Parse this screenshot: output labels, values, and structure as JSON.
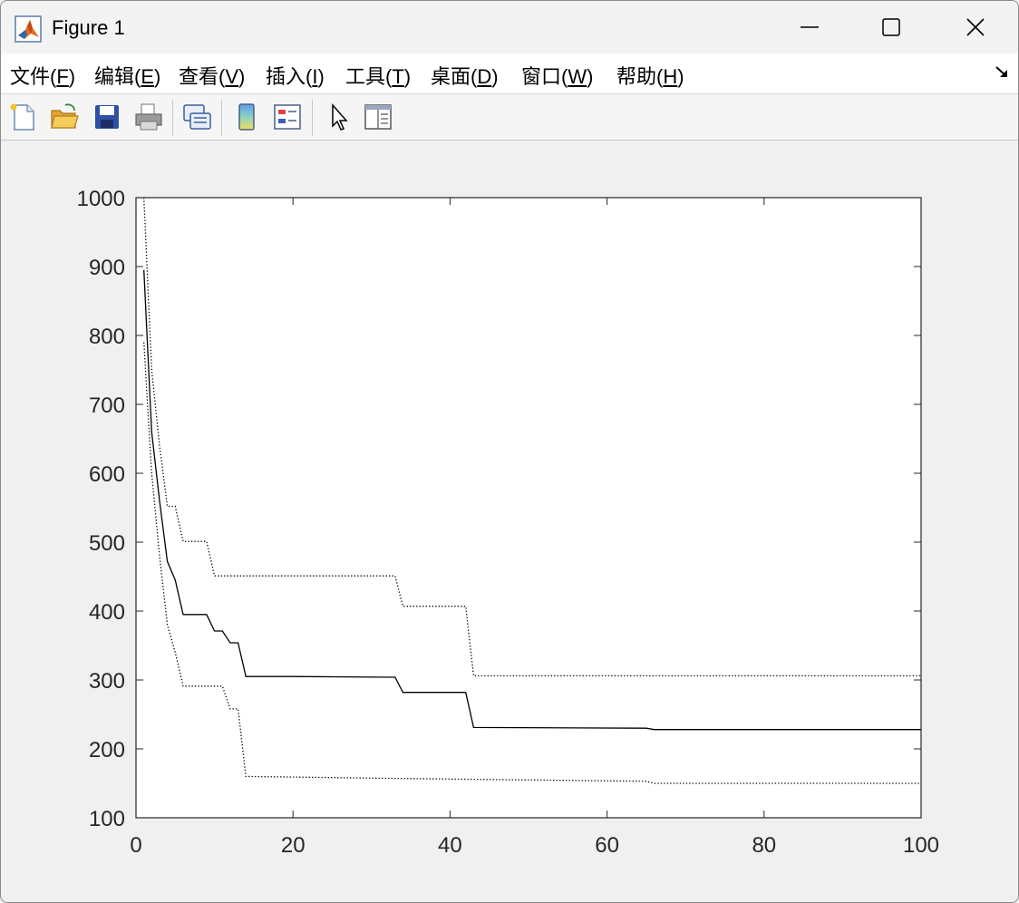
{
  "window": {
    "title": "Figure 1"
  },
  "menu": [
    {
      "pre": "文件(",
      "key": "F",
      "post": ")"
    },
    {
      "pre": "编辑(",
      "key": "E",
      "post": ")"
    },
    {
      "pre": "查看(",
      "key": "V",
      "post": ")"
    },
    {
      "pre": "插入(",
      "key": "I",
      "post": ")"
    },
    {
      "pre": "工具(",
      "key": "T",
      "post": ")"
    },
    {
      "pre": "桌面(",
      "key": "D",
      "post": ")"
    },
    {
      "pre": "窗口(",
      "key": "W",
      "post": ")"
    },
    {
      "pre": "帮助(",
      "key": "H",
      "post": ")"
    }
  ],
  "toolbar_icons": [
    "new-figure-icon",
    "open-file-icon",
    "save-icon",
    "print-icon",
    "link-plot-icon",
    "colorbar-icon",
    "legend-icon",
    "pointer-icon",
    "property-editor-icon"
  ],
  "chart_data": {
    "type": "line",
    "title": "",
    "xlabel": "",
    "ylabel": "",
    "xlim": [
      0,
      100
    ],
    "ylim": [
      100,
      1000
    ],
    "xticks": [
      0,
      20,
      40,
      60,
      80,
      100
    ],
    "yticks": [
      100,
      200,
      300,
      400,
      500,
      600,
      700,
      800,
      900,
      1000
    ],
    "grid": false,
    "series": [
      {
        "style": "solid",
        "color": "#000000",
        "x": [
          1,
          2,
          3,
          4,
          5,
          6,
          7,
          8,
          9,
          10,
          11,
          12,
          13,
          14,
          20,
          33,
          34,
          42,
          43,
          65,
          66,
          100
        ],
        "y": [
          895,
          660,
          560,
          472,
          445,
          395,
          395,
          395,
          395,
          371,
          371,
          354,
          354,
          305,
          305,
          304,
          282,
          282,
          231,
          230,
          228,
          228
        ]
      },
      {
        "style": "dotted",
        "color": "#000000",
        "x": [
          1,
          2,
          3,
          4,
          5,
          6,
          9,
          10,
          11,
          33,
          34,
          42,
          43,
          100
        ],
        "y": [
          1000,
          750,
          640,
          552,
          552,
          501,
          501,
          451,
          451,
          451,
          407,
          407,
          306,
          306
        ]
      },
      {
        "style": "dotted",
        "color": "#000000",
        "x": [
          1,
          2,
          3,
          4,
          5,
          6,
          11,
          12,
          13,
          14,
          34,
          65,
          66,
          100
        ],
        "y": [
          790,
          600,
          480,
          380,
          340,
          291,
          291,
          258,
          258,
          160,
          157,
          153,
          150,
          150
        ]
      }
    ]
  }
}
